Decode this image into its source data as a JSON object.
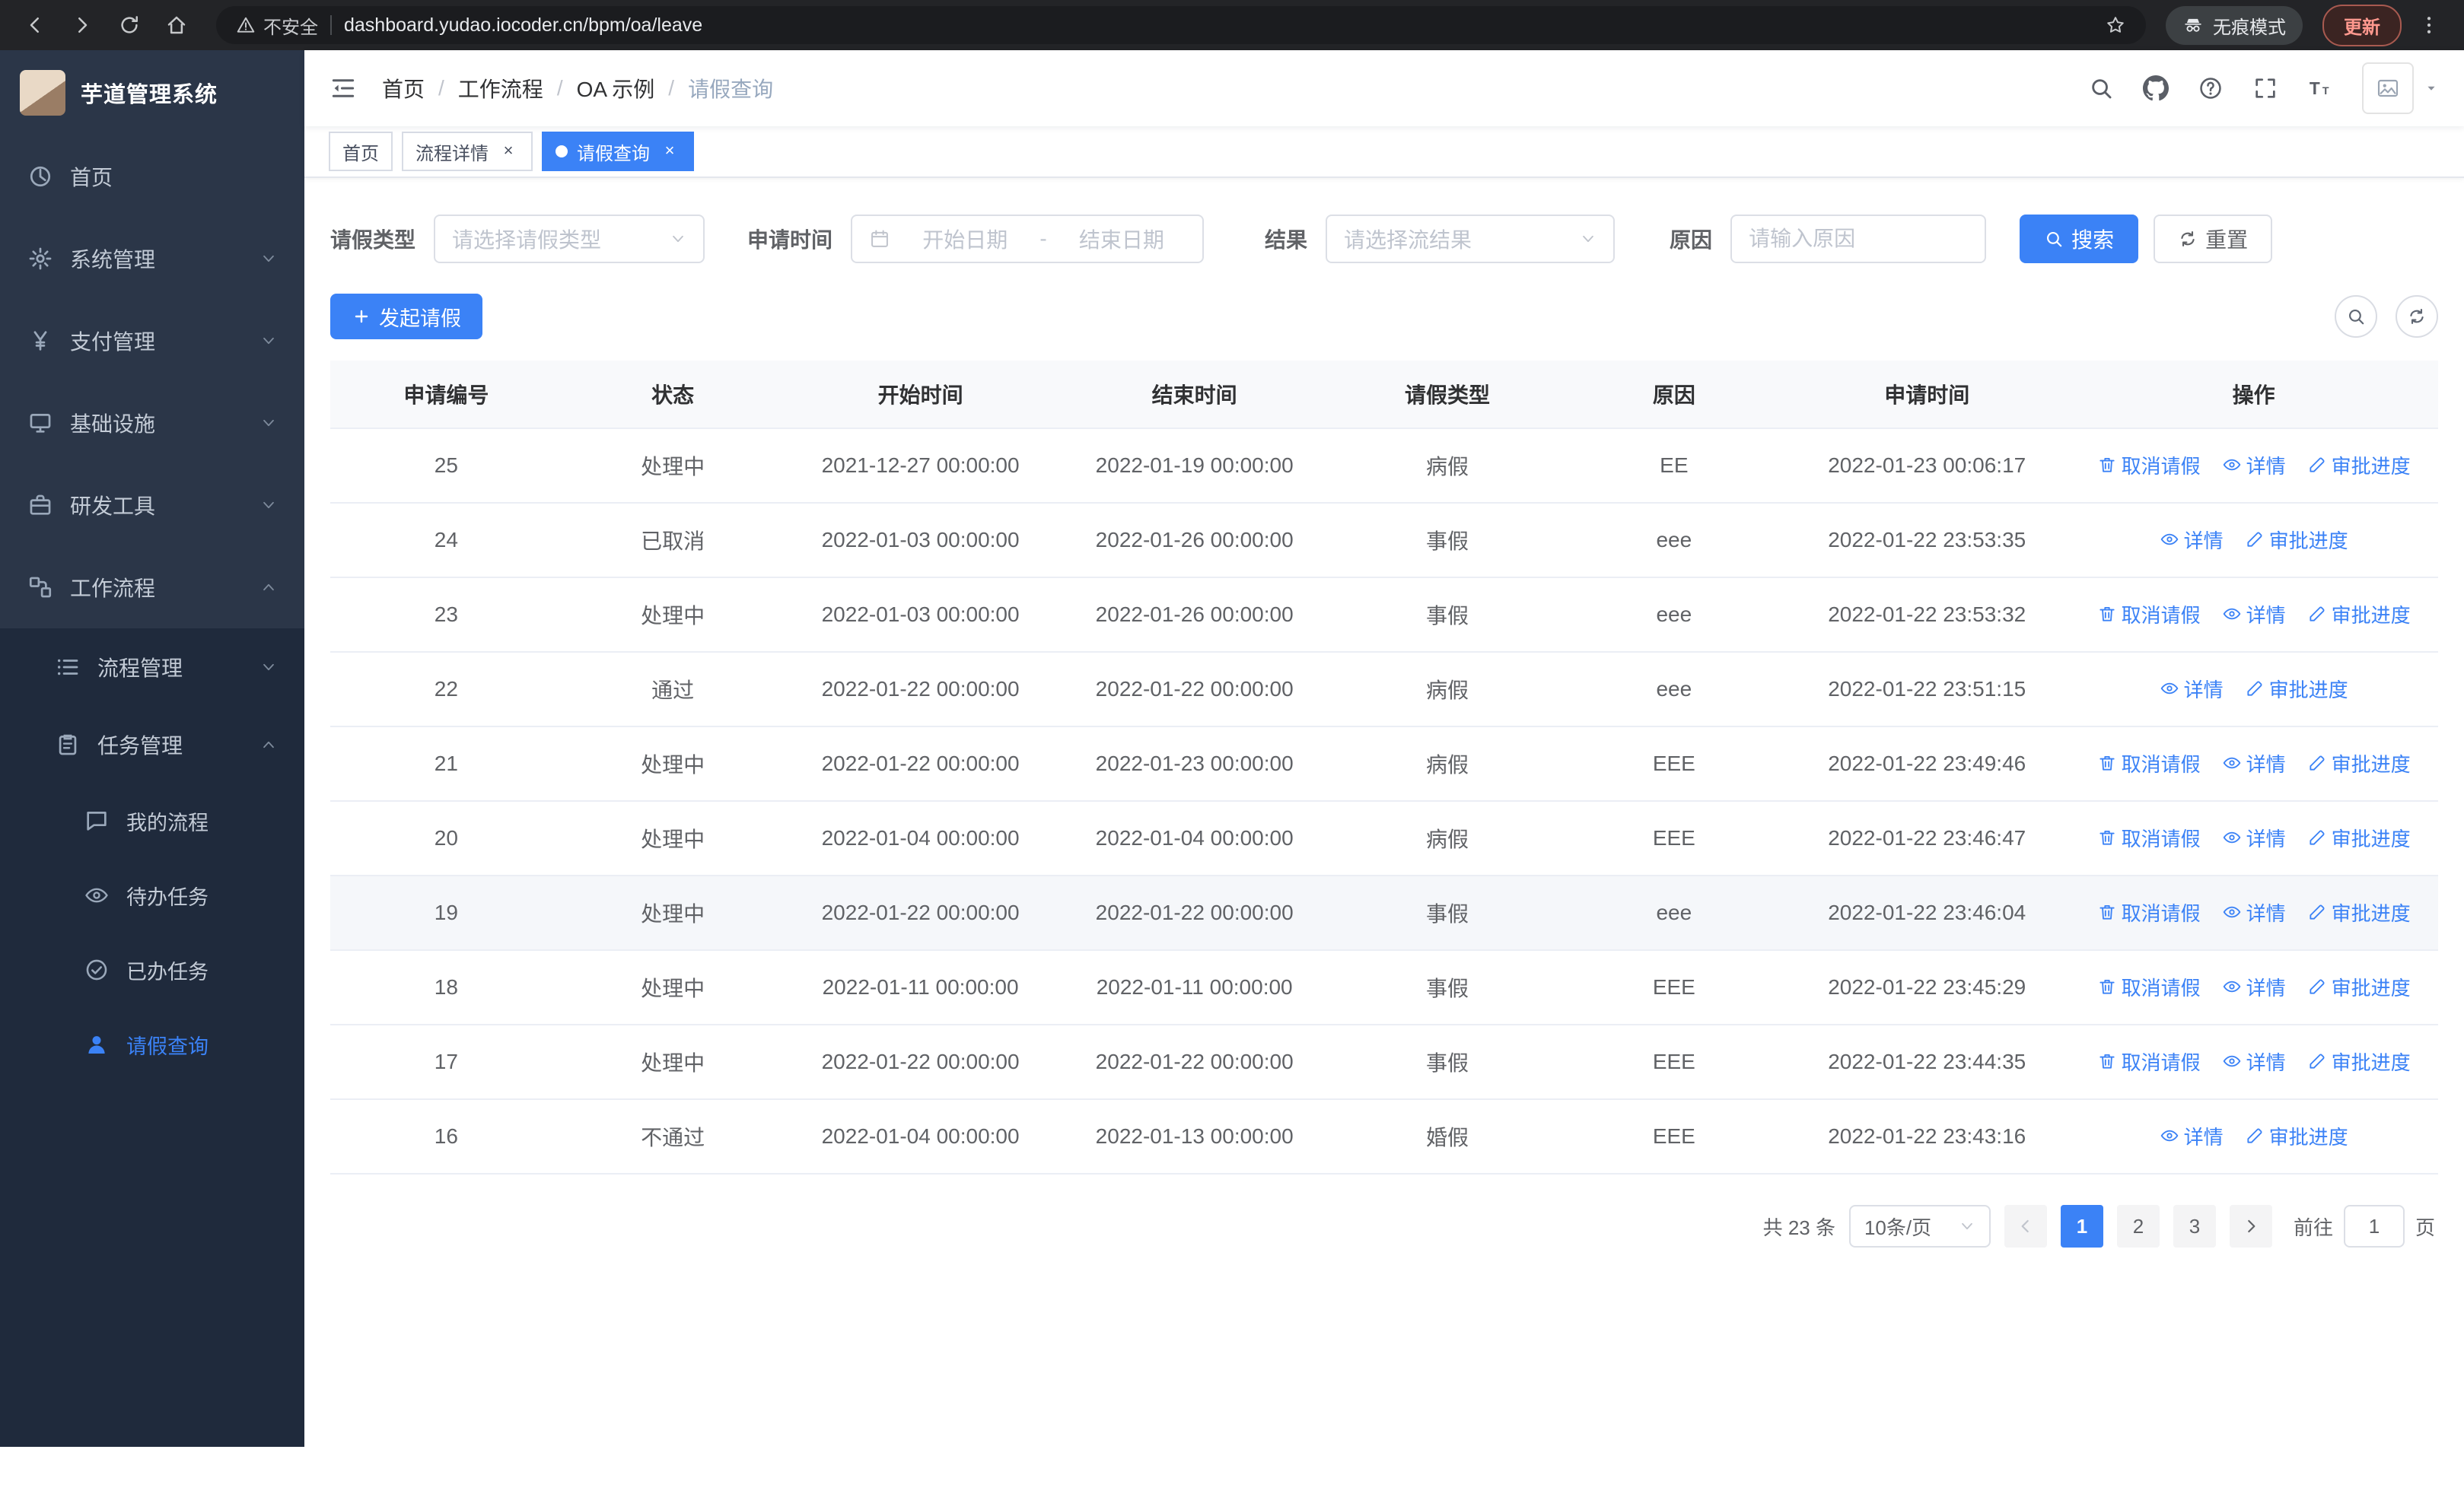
{
  "colors": {
    "primary": "#3b82f6",
    "sidebar_bg": "#2b3648",
    "submenu_bg": "#1f2a3c"
  },
  "browser": {
    "security_warning": "不安全",
    "url": "dashboard.yudao.iocoder.cn/bpm/oa/leave",
    "incognito_label": "无痕模式",
    "update_label": "更新"
  },
  "sidebar": {
    "app_title": "芋道管理系统",
    "items": [
      {
        "label": "首页",
        "icon": "dashboard-icon"
      },
      {
        "label": "系统管理",
        "icon": "gear-icon",
        "chevron": "down"
      },
      {
        "label": "支付管理",
        "icon": "yen-icon",
        "chevron": "down"
      },
      {
        "label": "基础设施",
        "icon": "infra-icon",
        "chevron": "down"
      },
      {
        "label": "研发工具",
        "icon": "tools-icon",
        "chevron": "down"
      },
      {
        "label": "工作流程",
        "icon": "workflow-icon",
        "chevron": "up",
        "open": true
      }
    ],
    "submenu": [
      {
        "label": "流程管理",
        "icon": "process-icon",
        "chevron": "down"
      },
      {
        "label": "任务管理",
        "icon": "task-icon",
        "chevron": "up",
        "open": true
      }
    ],
    "task_children": [
      {
        "label": "我的流程",
        "icon": "message-icon"
      },
      {
        "label": "待办任务",
        "icon": "eye-icon"
      },
      {
        "label": "已办任务",
        "icon": "done-icon"
      },
      {
        "label": "请假查询",
        "icon": "user-icon",
        "active": true
      }
    ]
  },
  "header": {
    "breadcrumb": [
      "首页",
      "工作流程",
      "OA 示例",
      "请假查询"
    ]
  },
  "tabs": [
    {
      "label": "首页",
      "closable": false,
      "active": false
    },
    {
      "label": "流程详情",
      "closable": true,
      "active": false
    },
    {
      "label": "请假查询",
      "closable": true,
      "active": true
    }
  ],
  "filters": {
    "type_label": "请假类型",
    "type_placeholder": "请选择请假类型",
    "time_label": "申请时间",
    "start_placeholder": "开始日期",
    "separator": "-",
    "end_placeholder": "结束日期",
    "result_label": "结果",
    "result_placeholder": "请选择流结果",
    "reason_label": "原因",
    "reason_placeholder": "请输入原因",
    "search_label": "搜索",
    "reset_label": "重置"
  },
  "toolbar": {
    "create_label": "发起请假"
  },
  "table": {
    "columns": [
      "申请编号",
      "状态",
      "开始时间",
      "结束时间",
      "请假类型",
      "原因",
      "申请时间",
      "操作"
    ],
    "action_labels": {
      "cancel": "取消请假",
      "detail": "详情",
      "progress": "审批进度"
    },
    "rows": [
      {
        "id": "25",
        "status": "处理中",
        "start": "2021-12-27 00:00:00",
        "end": "2022-01-19 00:00:00",
        "type": "病假",
        "reason": "EE",
        "apply_time": "2022-01-23 00:06:17",
        "actions": [
          "cancel",
          "detail",
          "progress"
        ]
      },
      {
        "id": "24",
        "status": "已取消",
        "start": "2022-01-03 00:00:00",
        "end": "2022-01-26 00:00:00",
        "type": "事假",
        "reason": "eee",
        "apply_time": "2022-01-22 23:53:35",
        "actions": [
          "detail",
          "progress"
        ]
      },
      {
        "id": "23",
        "status": "处理中",
        "start": "2022-01-03 00:00:00",
        "end": "2022-01-26 00:00:00",
        "type": "事假",
        "reason": "eee",
        "apply_time": "2022-01-22 23:53:32",
        "actions": [
          "cancel",
          "detail",
          "progress"
        ]
      },
      {
        "id": "22",
        "status": "通过",
        "start": "2022-01-22 00:00:00",
        "end": "2022-01-22 00:00:00",
        "type": "病假",
        "reason": "eee",
        "apply_time": "2022-01-22 23:51:15",
        "actions": [
          "detail",
          "progress"
        ]
      },
      {
        "id": "21",
        "status": "处理中",
        "start": "2022-01-22 00:00:00",
        "end": "2022-01-23 00:00:00",
        "type": "病假",
        "reason": "EEE",
        "apply_time": "2022-01-22 23:49:46",
        "actions": [
          "cancel",
          "detail",
          "progress"
        ]
      },
      {
        "id": "20",
        "status": "处理中",
        "start": "2022-01-04 00:00:00",
        "end": "2022-01-04 00:00:00",
        "type": "病假",
        "reason": "EEE",
        "apply_time": "2022-01-22 23:46:47",
        "actions": [
          "cancel",
          "detail",
          "progress"
        ]
      },
      {
        "id": "19",
        "status": "处理中",
        "start": "2022-01-22 00:00:00",
        "end": "2022-01-22 00:00:00",
        "type": "事假",
        "reason": "eee",
        "apply_time": "2022-01-22 23:46:04",
        "actions": [
          "cancel",
          "detail",
          "progress"
        ],
        "highlight": true
      },
      {
        "id": "18",
        "status": "处理中",
        "start": "2022-01-11 00:00:00",
        "end": "2022-01-11 00:00:00",
        "type": "事假",
        "reason": "EEE",
        "apply_time": "2022-01-22 23:45:29",
        "actions": [
          "cancel",
          "detail",
          "progress"
        ]
      },
      {
        "id": "17",
        "status": "处理中",
        "start": "2022-01-22 00:00:00",
        "end": "2022-01-22 00:00:00",
        "type": "事假",
        "reason": "EEE",
        "apply_time": "2022-01-22 23:44:35",
        "actions": [
          "cancel",
          "detail",
          "progress"
        ]
      },
      {
        "id": "16",
        "status": "不通过",
        "start": "2022-01-04 00:00:00",
        "end": "2022-01-13 00:00:00",
        "type": "婚假",
        "reason": "EEE",
        "apply_time": "2022-01-22 23:43:16",
        "actions": [
          "detail",
          "progress"
        ]
      }
    ]
  },
  "pagination": {
    "total_label": "共 23 条",
    "page_size": "10条/页",
    "pages": [
      "1",
      "2",
      "3"
    ],
    "active_page": "1",
    "goto_label": "前往",
    "goto_value": "1",
    "goto_suffix": "页"
  }
}
